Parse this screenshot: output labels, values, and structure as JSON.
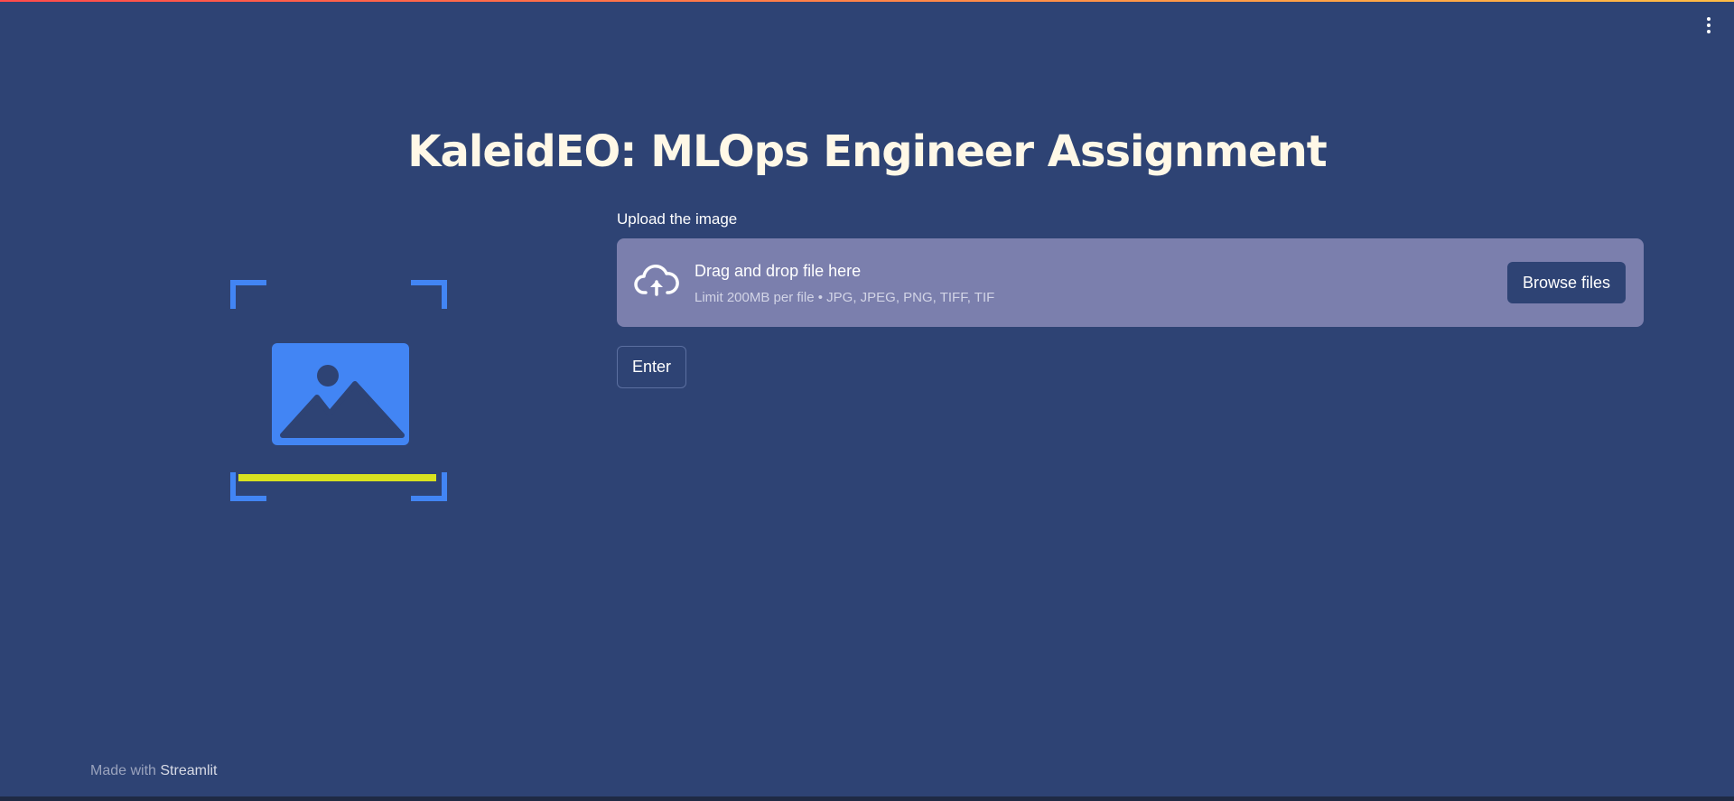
{
  "app": {
    "title": "KaleidEO: MLOps Engineer Assignment",
    "menu_icon": "kebab-menu-icon",
    "logo_icon": "image-scan-icon"
  },
  "uploader": {
    "label": "Upload the image",
    "drop_title": "Drag and drop file here",
    "drop_subtitle": "Limit 200MB per file • JPG, JPEG, PNG, TIFF, TIF",
    "upload_icon": "cloud-upload-icon",
    "browse_label": "Browse files"
  },
  "actions": {
    "enter_label": "Enter"
  },
  "footer": {
    "made_with": "Made with ",
    "brand": "Streamlit"
  },
  "colors": {
    "background": "#2e4374",
    "dropzone": "#7b7fad",
    "title": "#fff8e7",
    "logo_blue": "#4285f4",
    "scan_line": "#d9e21f"
  }
}
